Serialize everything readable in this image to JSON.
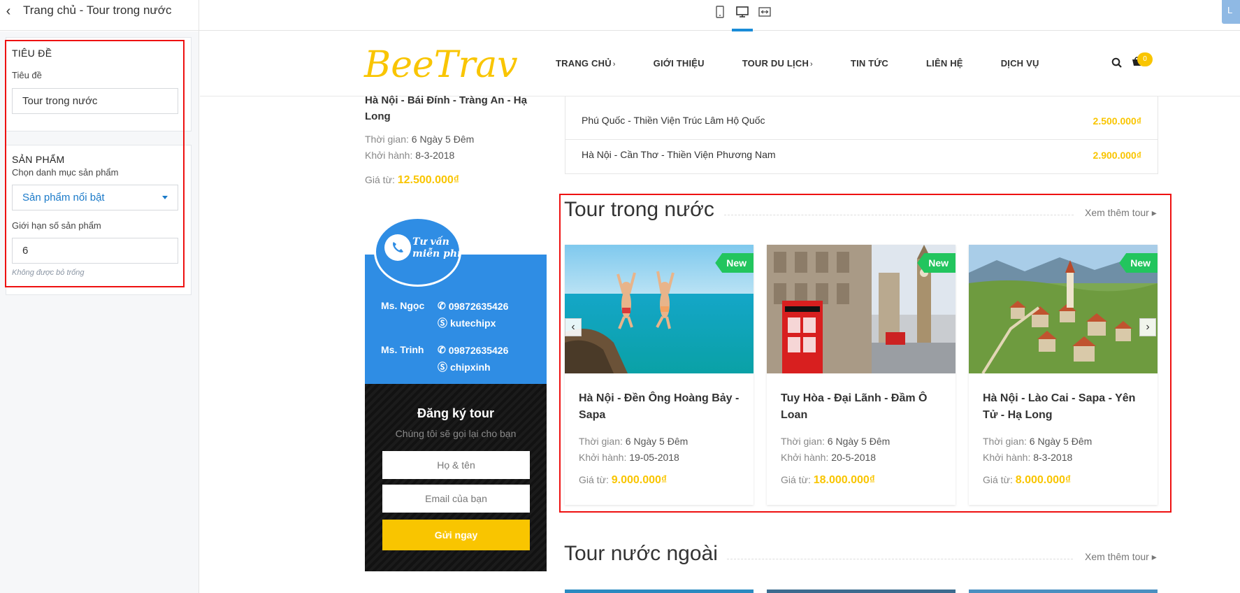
{
  "editor": {
    "title": "Trang chủ - Tour trong nước",
    "top_right_label": "L"
  },
  "panel": {
    "title_section": {
      "heading": "TIÊU ĐỀ",
      "label": "Tiêu đề",
      "value": "Tour trong nước"
    },
    "product_section": {
      "heading": "SẢN PHẨM",
      "category_label": "Chọn danh mục sản phẩm",
      "category_value": "Sản phẩm nổi bật",
      "limit_label": "Giới hạn số sản phẩm",
      "limit_value": "6",
      "limit_hint": "Không được bỏ trống"
    }
  },
  "site": {
    "logo_text": "BeeTravel",
    "nav": [
      "TRANG CHỦ",
      "GIỚI THIỆU",
      "TOUR DU LỊCH",
      "TIN TỨC",
      "LIÊN HỆ",
      "DỊCH VỤ"
    ],
    "cart_count": "0",
    "left_tour": {
      "name": "Hà Nội - Bái Đính - Tràng An - Hạ Long",
      "time_label": "Thời gian:",
      "time_value": "6 Ngày 5 Đêm",
      "depart_label": "Khởi hành:",
      "depart_value": "8-3-2018",
      "price_label": "Giá từ:",
      "price_value": "12.500.000₫"
    },
    "consult": {
      "bubble_line1": "Tư vấn",
      "bubble_line2": "miễn phí",
      "contacts": [
        {
          "name": "Ms. Ngọc",
          "phone": "09872635426",
          "skype": "kutechipx"
        },
        {
          "name": "Ms. Trinh",
          "phone": "09872635426",
          "skype": "chipxinh"
        }
      ]
    },
    "register": {
      "title": "Đăng ký tour",
      "subtitle": "Chúng tôi sẽ gọi lại cho bạn",
      "name_placeholder": "Họ & tên",
      "email_placeholder": "Email của bạn",
      "submit": "Gửi ngay"
    },
    "price_rows": [
      {
        "name": "Phú Quốc - Thiền Viện Trúc Lâm Hộ Quốc",
        "price": "2.500.000₫"
      },
      {
        "name": "Hà Nội - Cần Thơ - Thiền Viện Phương Nam",
        "price": "2.900.000₫"
      }
    ],
    "domestic": {
      "title": "Tour trong nước",
      "more": "Xem thêm tour",
      "badge": "New",
      "tours": [
        {
          "name": "Hà Nội - Đền Ông Hoàng Bảy - Sapa",
          "time": "6 Ngày 5 Đêm",
          "depart": "19-05-2018",
          "price": "9.000.000₫"
        },
        {
          "name": "Tuy Hòa - Đại Lãnh - Đầm Ô Loan",
          "time": "6 Ngày 5 Đêm",
          "depart": "20-5-2018",
          "price": "18.000.000₫"
        },
        {
          "name": "Hà Nội - Lào Cai - Sapa - Yên Tử - Hạ Long",
          "time": "6 Ngày 5 Đêm",
          "depart": "8-3-2018",
          "price": "8.000.000₫"
        }
      ],
      "time_label": "Thời gian:",
      "depart_label": "Khởi hành:",
      "price_label": "Giá từ:"
    },
    "international": {
      "title": "Tour nước ngoài",
      "more": "Xem thêm tour"
    }
  },
  "colors": {
    "accent_yellow": "#f9c500",
    "badge_green": "#22c55e",
    "consult_blue": "#2f8de4",
    "highlight_red": "#e11111"
  }
}
